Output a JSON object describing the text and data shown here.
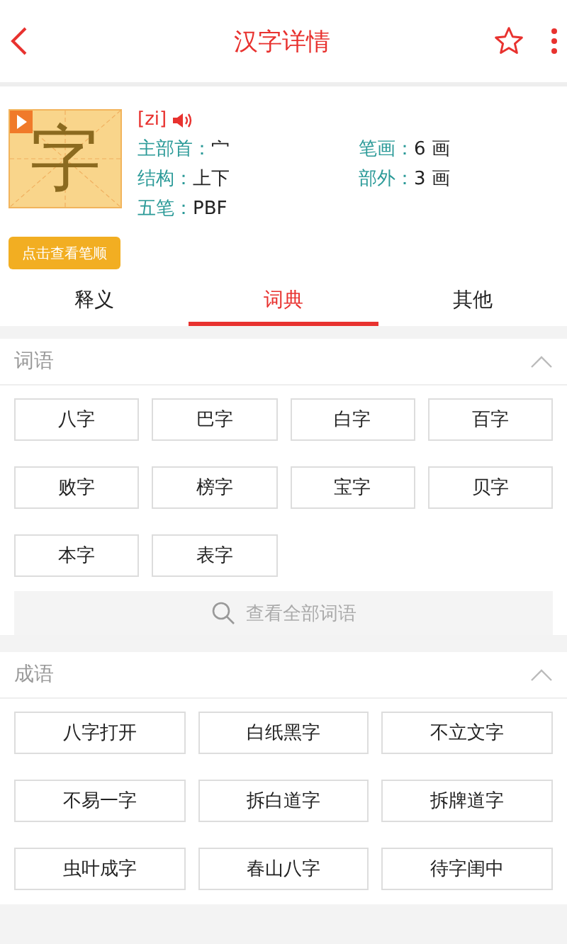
{
  "header": {
    "title": "汉字详情"
  },
  "character": {
    "glyph": "字",
    "pinyin": "[zi]",
    "stroke_button": "点击查看笔顺"
  },
  "info": [
    {
      "label": "主部首：",
      "value": "宀"
    },
    {
      "label": "笔画：",
      "value": "6 画"
    },
    {
      "label": "结构：",
      "value": "上下"
    },
    {
      "label": "部外：",
      "value": "3 画"
    },
    {
      "label": "五笔：",
      "value": "PBF"
    }
  ],
  "tabs": [
    {
      "label": "释义",
      "selected": false
    },
    {
      "label": "词典",
      "selected": true
    },
    {
      "label": "其他",
      "selected": false
    }
  ],
  "sections": [
    {
      "title": "词语",
      "kind": "words",
      "items": [
        "八字",
        "巴字",
        "白字",
        "百字",
        "败字",
        "榜字",
        "宝字",
        "贝字",
        "本字",
        "表字"
      ],
      "more": "查看全部词语"
    },
    {
      "title": "成语",
      "kind": "idioms",
      "items": [
        "八字打开",
        "白纸黑字",
        "不立文字",
        "不易一字",
        "拆白道字",
        "拆牌道字",
        "虫叶成字",
        "春山八字",
        "待字闺中"
      ]
    }
  ]
}
